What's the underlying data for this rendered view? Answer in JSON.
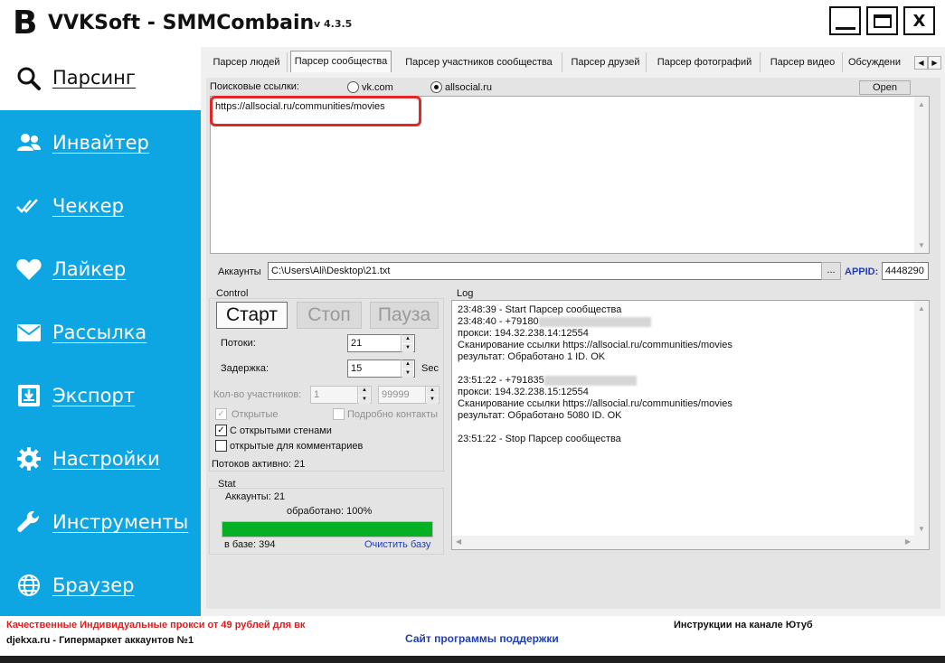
{
  "window": {
    "logo_letter": "B",
    "title": "VVKSoft - SMMCombain",
    "version": "v 4.3.5",
    "close_glyph": "X"
  },
  "sidebar": {
    "active_item": {
      "label": "Парсинг",
      "icon": "search-icon"
    },
    "items": [
      {
        "label": "Инвайтер",
        "icon": "users-icon"
      },
      {
        "label": "Чеккер",
        "icon": "double-check-icon"
      },
      {
        "label": "Лайкер",
        "icon": "heart-icon"
      },
      {
        "label": "Рассылка",
        "icon": "envelope-icon"
      },
      {
        "label": "Экспорт",
        "icon": "export-icon"
      },
      {
        "label": "Настройки",
        "icon": "gear-icon"
      },
      {
        "label": "Инструменты",
        "icon": "wrench-icon"
      },
      {
        "label": "Браузер",
        "icon": "globe-icon"
      }
    ],
    "colors": {
      "background": "#0ea5e3",
      "text": "#ffffff"
    }
  },
  "tabs": {
    "items": [
      "Парсер людей",
      "Парсер сообщества",
      "Парсер участников сообщества",
      "Парсер друзей",
      "Парсер фотографий",
      "Парсер видео",
      "Обсуждени"
    ],
    "active": "Парсер сообщества"
  },
  "search": {
    "label": "Поисковые ссылки:",
    "options": [
      "vk.com",
      "allsocial.ru"
    ],
    "selected": "allsocial.ru",
    "open_button": "Open",
    "links_value": "https://allsocial.ru/communities/movies"
  },
  "accounts": {
    "label": "Аккаунты",
    "path": "C:\\Users\\Ali\\Desktop\\21.txt",
    "browse_button": "...",
    "appid_label": "APPID:",
    "appid_value": "4448290"
  },
  "control": {
    "title": "Control",
    "start": "Старт",
    "stop": "Стоп",
    "pause": "Пауза",
    "threads_label": "Потоки:",
    "threads_value": "21",
    "delay_label": "Задержка:",
    "delay_value": "15",
    "delay_unit": "Sec",
    "members_label": "Кол-во участников:",
    "members_min": "1",
    "members_max": "99999",
    "open_label": "Открытые",
    "open_checked": true,
    "detailed_contacts_label": "Подробно контакты",
    "detailed_contacts_checked": false,
    "open_walls_label": "С открытыми стенами",
    "open_walls_checked": true,
    "open_comments_label": "открытые для комментариев",
    "open_comments_checked": false,
    "threads_active": "Потоков активно: 21"
  },
  "stat": {
    "title": "Stat",
    "accounts": "Аккаунты: 21",
    "processed": "обработано: 100%",
    "progress": 1.0,
    "in_base": "в базе: 394",
    "clear_base": "Очистить базу"
  },
  "log": {
    "title": "Log",
    "lines": [
      "23:48:39 - Start Парсер сообщества",
      "23:48:40 - +79180",
      "прокси: 194.32.238.14:12554",
      "Сканирование ссылки https://allsocial.ru/communities/movies",
      "результат: Обработано 1 ID. OK",
      "23:51:22 - +791835",
      "прокси: 194.32.238.15:12554",
      "Сканирование ссылки https://allsocial.ru/communities/movies",
      "результат: Обработано 5080 ID. OK",
      "23:51:22 - Stop Парсер сообщества"
    ]
  },
  "footer": {
    "proxy_ad": "Качественные Индивидуальные прокси от 49 рублей для вк",
    "shop": "djekxa.ru - Гипермаркет аккаунтов №1",
    "support_site": "Сайт программы поддержки",
    "youtube": "Инструкции на канале Ютуб",
    "colors": {
      "proxy_ad": "#e01b1b",
      "support": "#1f3fb8"
    }
  }
}
